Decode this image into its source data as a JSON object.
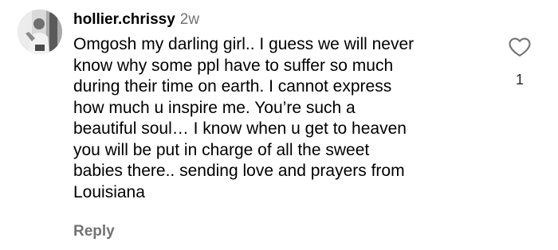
{
  "comment": {
    "username": "hollier.chrissy",
    "timestamp": "2w",
    "text_lines": [
      "Omgosh my darling girl.. I guess we will never",
      "know why some ppl have to suffer so much",
      "during their time on earth. I cannot express",
      "how much u inspire me. You’re such a",
      "beautiful soul… I know when u get to heaven",
      "you will be put in charge of all the sweet",
      "babies there.. sending love and prayers from",
      "Louisiana"
    ],
    "reply_label": "Reply",
    "like_count": "1",
    "avatar_icon": "user-photo",
    "like_icon": "heart-outline-icon"
  },
  "colors": {
    "text": "#000000",
    "muted": "#737373",
    "background": "#ffffff"
  }
}
